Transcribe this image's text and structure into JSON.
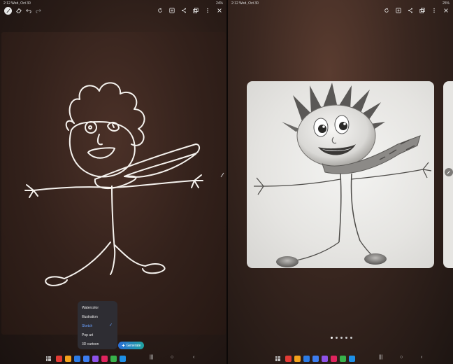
{
  "left": {
    "status": {
      "time": "2:12",
      "date": "Wed, Oct 30",
      "battery": "24%"
    },
    "style_menu": {
      "items": [
        {
          "label": "Watercolor",
          "selected": false
        },
        {
          "label": "Illustration",
          "selected": false
        },
        {
          "label": "Sketch",
          "selected": true
        },
        {
          "label": "Pop art",
          "selected": false
        },
        {
          "label": "3D cartoon",
          "selected": false
        }
      ],
      "check": "✓"
    },
    "generate_label": "Generate"
  },
  "right": {
    "status": {
      "time": "2:12",
      "date": "Wed, Oct 30",
      "battery": "25%"
    },
    "pager": {
      "count": 5,
      "active_index": 0
    }
  },
  "icons": {
    "toolbar_left": [
      "pen-icon",
      "eraser-icon",
      "undo-icon",
      "redo-icon"
    ],
    "toolbar_right": [
      "refresh-icon",
      "save-image-icon",
      "share-icon",
      "copy-icon",
      "more-icon",
      "close-icon"
    ]
  },
  "dock_colors": [
    "#e23b35",
    "#f4a21c",
    "#2c7be5",
    "#3d7df0",
    "#8e52e8",
    "#e0245e",
    "#38b24a",
    "#1d8fe6"
  ],
  "colors": {
    "accent": "#6aa1ff",
    "generate_start": "#2b6fd8",
    "generate_end": "#1fa3a0"
  }
}
